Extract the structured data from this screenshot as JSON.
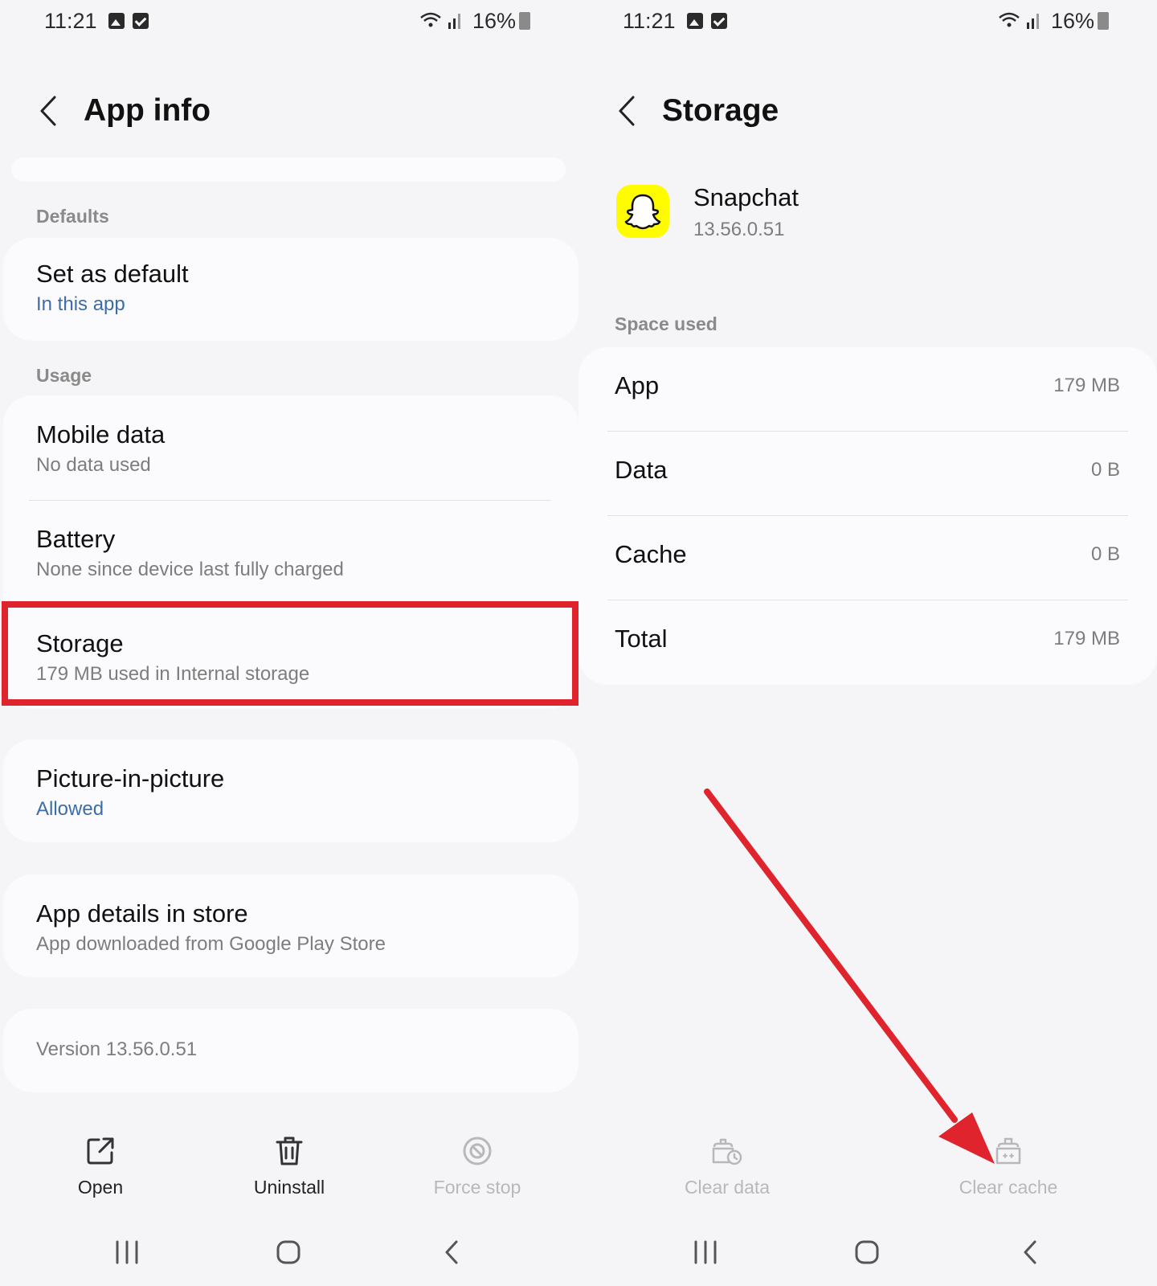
{
  "status_bar": {
    "time": "11:21",
    "battery": "16%"
  },
  "left": {
    "header": {
      "title": "App info"
    },
    "sections": {
      "defaults": "Defaults",
      "usage": "Usage"
    },
    "set_default": {
      "title": "Set as default",
      "sub": "In this app"
    },
    "mobile_data": {
      "title": "Mobile data",
      "sub": "No data used"
    },
    "battery": {
      "title": "Battery",
      "sub": "None since device last fully charged"
    },
    "storage": {
      "title": "Storage",
      "sub": "179 MB used in Internal storage"
    },
    "pip": {
      "title": "Picture-in-picture",
      "sub": "Allowed"
    },
    "store": {
      "title": "App details in store",
      "sub": "App downloaded from Google Play Store"
    },
    "version": "Version 13.56.0.51",
    "actions": {
      "open": "Open",
      "uninstall": "Uninstall",
      "force_stop": "Force stop"
    }
  },
  "right": {
    "header": {
      "title": "Storage"
    },
    "app": {
      "name": "Snapchat",
      "version": "13.56.0.51"
    },
    "section": "Space used",
    "rows": [
      {
        "label": "App",
        "value": "179 MB"
      },
      {
        "label": "Data",
        "value": "0 B"
      },
      {
        "label": "Cache",
        "value": "0 B"
      },
      {
        "label": "Total",
        "value": "179 MB"
      }
    ],
    "actions": {
      "clear_data": "Clear data",
      "clear_cache": "Clear cache"
    }
  },
  "colors": {
    "highlight": "#e0242d",
    "link_blue": "#3d6ca8",
    "snapchat_yellow": "#fffc00"
  }
}
